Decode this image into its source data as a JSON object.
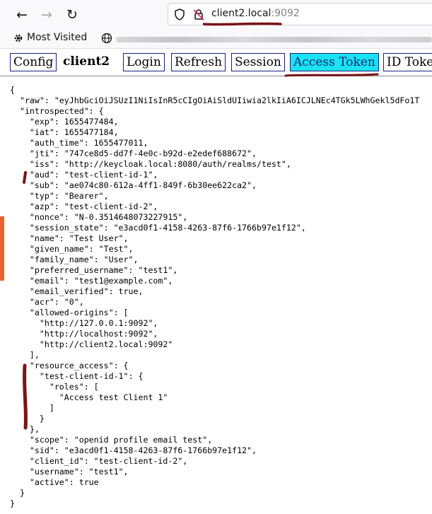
{
  "browser": {
    "url_host": "client2.local",
    "url_port": ":9092",
    "bookmarks": {
      "most_visited": "Most Visited"
    }
  },
  "app": {
    "nav": {
      "config": "Config",
      "brand": "client2",
      "login": "Login",
      "refresh": "Refresh",
      "session": "Session",
      "access_token": "Access Token",
      "id_token": "ID Token"
    },
    "active_tab": "Access Token",
    "active_color": "#19e3f0"
  },
  "token_json": "{\n  \"raw\": \"eyJhbGciOiJSUzI1NiIsInR5cCIgOiAiSldUIiwia2lkIiA6ICJLNEc4TGk5LWhGekl5dFo1T\n  \"introspected\": {\n    \"exp\": 1655477484,\n    \"iat\": 1655477184,\n    \"auth_time\": 1655477011,\n    \"jti\": \"747ce8d5-dd7f-4e0c-b92d-e2edef688672\",\n    \"iss\": \"http://keycloak.local:8080/auth/realms/test\",\n    \"aud\": \"test-client-id-1\",\n    \"sub\": \"ae074c80-612a-4ff1-849f-6b30ee622ca2\",\n    \"typ\": \"Bearer\",\n    \"azp\": \"test-client-id-2\",\n    \"nonce\": \"N-0.3514648073227915\",\n    \"session_state\": \"e3acd0f1-4158-4263-87f6-1766b97e1f12\",\n    \"name\": \"Test User\",\n    \"given_name\": \"Test\",\n    \"family_name\": \"User\",\n    \"preferred_username\": \"test1\",\n    \"email\": \"test1@example.com\",\n    \"email_verified\": true,\n    \"acr\": \"0\",\n    \"allowed-origins\": [\n      \"http://127.0.0.1:9092\",\n      \"http://localhost:9092\",\n      \"http://client2.local:9092\"\n    ],\n    \"resource_access\": {\n      \"test-client-id-1\": {\n        \"roles\": [\n          \"Access test Client 1\"\n        ]\n      }\n    },\n    \"scope\": \"openid profile email test\",\n    \"sid\": \"e3acd0f1-4158-4263-87f6-1766b97e1f12\",\n    \"client_id\": \"test-client-id-2\",\n    \"username\": \"test1\",\n    \"active\": true\n  }\n}"
}
